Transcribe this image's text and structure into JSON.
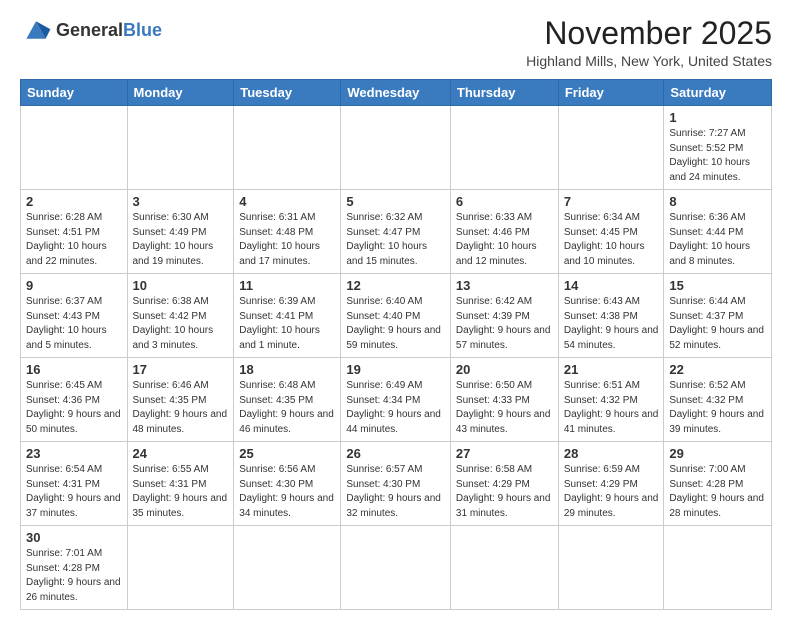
{
  "header": {
    "logo_general": "General",
    "logo_blue": "Blue",
    "month_title": "November 2025",
    "location": "Highland Mills, New York, United States"
  },
  "days_of_week": [
    "Sunday",
    "Monday",
    "Tuesday",
    "Wednesday",
    "Thursday",
    "Friday",
    "Saturday"
  ],
  "weeks": [
    [
      {
        "day": "",
        "info": ""
      },
      {
        "day": "",
        "info": ""
      },
      {
        "day": "",
        "info": ""
      },
      {
        "day": "",
        "info": ""
      },
      {
        "day": "",
        "info": ""
      },
      {
        "day": "",
        "info": ""
      },
      {
        "day": "1",
        "info": "Sunrise: 7:27 AM\nSunset: 5:52 PM\nDaylight: 10 hours and 24 minutes."
      }
    ],
    [
      {
        "day": "2",
        "info": "Sunrise: 6:28 AM\nSunset: 4:51 PM\nDaylight: 10 hours and 22 minutes."
      },
      {
        "day": "3",
        "info": "Sunrise: 6:30 AM\nSunset: 4:49 PM\nDaylight: 10 hours and 19 minutes."
      },
      {
        "day": "4",
        "info": "Sunrise: 6:31 AM\nSunset: 4:48 PM\nDaylight: 10 hours and 17 minutes."
      },
      {
        "day": "5",
        "info": "Sunrise: 6:32 AM\nSunset: 4:47 PM\nDaylight: 10 hours and 15 minutes."
      },
      {
        "day": "6",
        "info": "Sunrise: 6:33 AM\nSunset: 4:46 PM\nDaylight: 10 hours and 12 minutes."
      },
      {
        "day": "7",
        "info": "Sunrise: 6:34 AM\nSunset: 4:45 PM\nDaylight: 10 hours and 10 minutes."
      },
      {
        "day": "8",
        "info": "Sunrise: 6:36 AM\nSunset: 4:44 PM\nDaylight: 10 hours and 8 minutes."
      }
    ],
    [
      {
        "day": "9",
        "info": "Sunrise: 6:37 AM\nSunset: 4:43 PM\nDaylight: 10 hours and 5 minutes."
      },
      {
        "day": "10",
        "info": "Sunrise: 6:38 AM\nSunset: 4:42 PM\nDaylight: 10 hours and 3 minutes."
      },
      {
        "day": "11",
        "info": "Sunrise: 6:39 AM\nSunset: 4:41 PM\nDaylight: 10 hours and 1 minute."
      },
      {
        "day": "12",
        "info": "Sunrise: 6:40 AM\nSunset: 4:40 PM\nDaylight: 9 hours and 59 minutes."
      },
      {
        "day": "13",
        "info": "Sunrise: 6:42 AM\nSunset: 4:39 PM\nDaylight: 9 hours and 57 minutes."
      },
      {
        "day": "14",
        "info": "Sunrise: 6:43 AM\nSunset: 4:38 PM\nDaylight: 9 hours and 54 minutes."
      },
      {
        "day": "15",
        "info": "Sunrise: 6:44 AM\nSunset: 4:37 PM\nDaylight: 9 hours and 52 minutes."
      }
    ],
    [
      {
        "day": "16",
        "info": "Sunrise: 6:45 AM\nSunset: 4:36 PM\nDaylight: 9 hours and 50 minutes."
      },
      {
        "day": "17",
        "info": "Sunrise: 6:46 AM\nSunset: 4:35 PM\nDaylight: 9 hours and 48 minutes."
      },
      {
        "day": "18",
        "info": "Sunrise: 6:48 AM\nSunset: 4:35 PM\nDaylight: 9 hours and 46 minutes."
      },
      {
        "day": "19",
        "info": "Sunrise: 6:49 AM\nSunset: 4:34 PM\nDaylight: 9 hours and 44 minutes."
      },
      {
        "day": "20",
        "info": "Sunrise: 6:50 AM\nSunset: 4:33 PM\nDaylight: 9 hours and 43 minutes."
      },
      {
        "day": "21",
        "info": "Sunrise: 6:51 AM\nSunset: 4:32 PM\nDaylight: 9 hours and 41 minutes."
      },
      {
        "day": "22",
        "info": "Sunrise: 6:52 AM\nSunset: 4:32 PM\nDaylight: 9 hours and 39 minutes."
      }
    ],
    [
      {
        "day": "23",
        "info": "Sunrise: 6:54 AM\nSunset: 4:31 PM\nDaylight: 9 hours and 37 minutes."
      },
      {
        "day": "24",
        "info": "Sunrise: 6:55 AM\nSunset: 4:31 PM\nDaylight: 9 hours and 35 minutes."
      },
      {
        "day": "25",
        "info": "Sunrise: 6:56 AM\nSunset: 4:30 PM\nDaylight: 9 hours and 34 minutes."
      },
      {
        "day": "26",
        "info": "Sunrise: 6:57 AM\nSunset: 4:30 PM\nDaylight: 9 hours and 32 minutes."
      },
      {
        "day": "27",
        "info": "Sunrise: 6:58 AM\nSunset: 4:29 PM\nDaylight: 9 hours and 31 minutes."
      },
      {
        "day": "28",
        "info": "Sunrise: 6:59 AM\nSunset: 4:29 PM\nDaylight: 9 hours and 29 minutes."
      },
      {
        "day": "29",
        "info": "Sunrise: 7:00 AM\nSunset: 4:28 PM\nDaylight: 9 hours and 28 minutes."
      }
    ],
    [
      {
        "day": "30",
        "info": "Sunrise: 7:01 AM\nSunset: 4:28 PM\nDaylight: 9 hours and 26 minutes."
      },
      {
        "day": "",
        "info": ""
      },
      {
        "day": "",
        "info": ""
      },
      {
        "day": "",
        "info": ""
      },
      {
        "day": "",
        "info": ""
      },
      {
        "day": "",
        "info": ""
      },
      {
        "day": "",
        "info": ""
      }
    ]
  ]
}
